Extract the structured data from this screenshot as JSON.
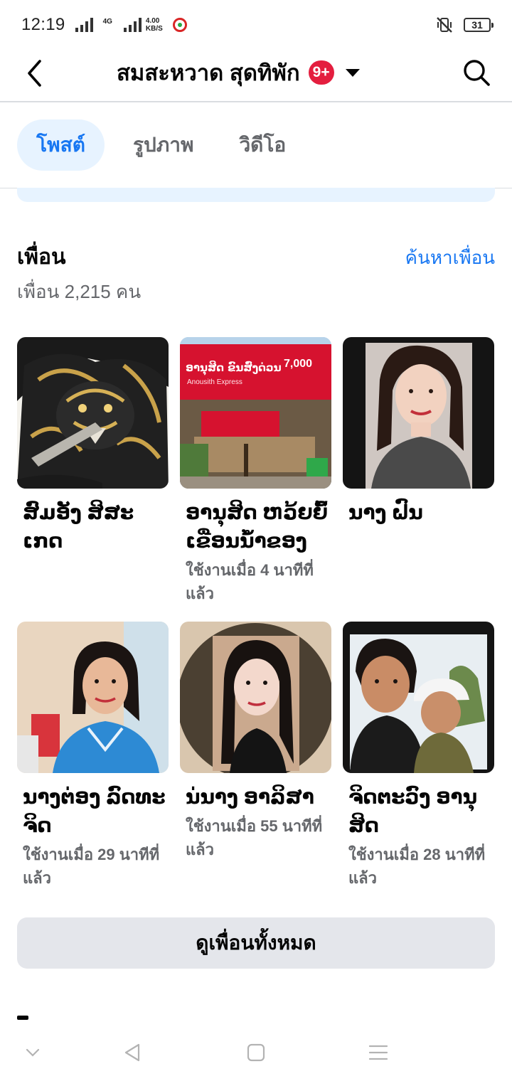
{
  "status_bar": {
    "time": "12:19",
    "network": "4G",
    "speed_value": "4.00",
    "speed_unit": "KB/S",
    "battery": "31"
  },
  "header": {
    "title": "สมสะหวาด สุดทิพัก",
    "badge": "9+",
    "back_icon": "chevron-left-icon",
    "search_icon": "search-icon"
  },
  "tabs": [
    {
      "label": "โพสต์",
      "active": true
    },
    {
      "label": "รูปภาพ",
      "active": false
    },
    {
      "label": "วิดีโอ",
      "active": false
    }
  ],
  "friends": {
    "title": "เพื่อน",
    "find_link": "ค้นหาเพื่อน",
    "count_text": "เพื่อน 2,215 คน",
    "items": [
      {
        "name": "ສົມອັງ ສິສະເກດ",
        "active": ""
      },
      {
        "name": "ອານຸສິດ ຫວ້ຍຍົ້ ເຂື່ອນນ້ຳຂອງ",
        "active": "ใช้งานเมื่อ 4 นาทีที่แล้ว"
      },
      {
        "name": "ນາງ ຝົນ",
        "active": ""
      },
      {
        "name": "ນາງຕ່ອງ ລົດທະຈິດ",
        "active": "ใช้งานเมื่อ 29 นาทีที่แล้ว"
      },
      {
        "name": "ນ່ນາງ ອາລິສາ",
        "active": "ใช้งานเมื่อ 55 นาทีที่แล้ว"
      },
      {
        "name": "ຈິດຕະວົງ ອານຸສິດ",
        "active": "ใช้งานเมื่อ 28 นาทีที่แล้ว"
      }
    ],
    "see_all": "ดูเพื่อนทั้งหมด"
  },
  "photo_texts": {
    "banner_headline": "ອານຸສິດ ຂົນສົ່ງດ່ວນ",
    "banner_sub": "Anousith Express",
    "banner_price": "7,000"
  },
  "colors": {
    "accent": "#1877f2",
    "tab_active_bg": "#e7f3ff",
    "badge": "#e41e3f",
    "secondary_text": "#65676b",
    "button_bg": "#e4e6eb"
  }
}
